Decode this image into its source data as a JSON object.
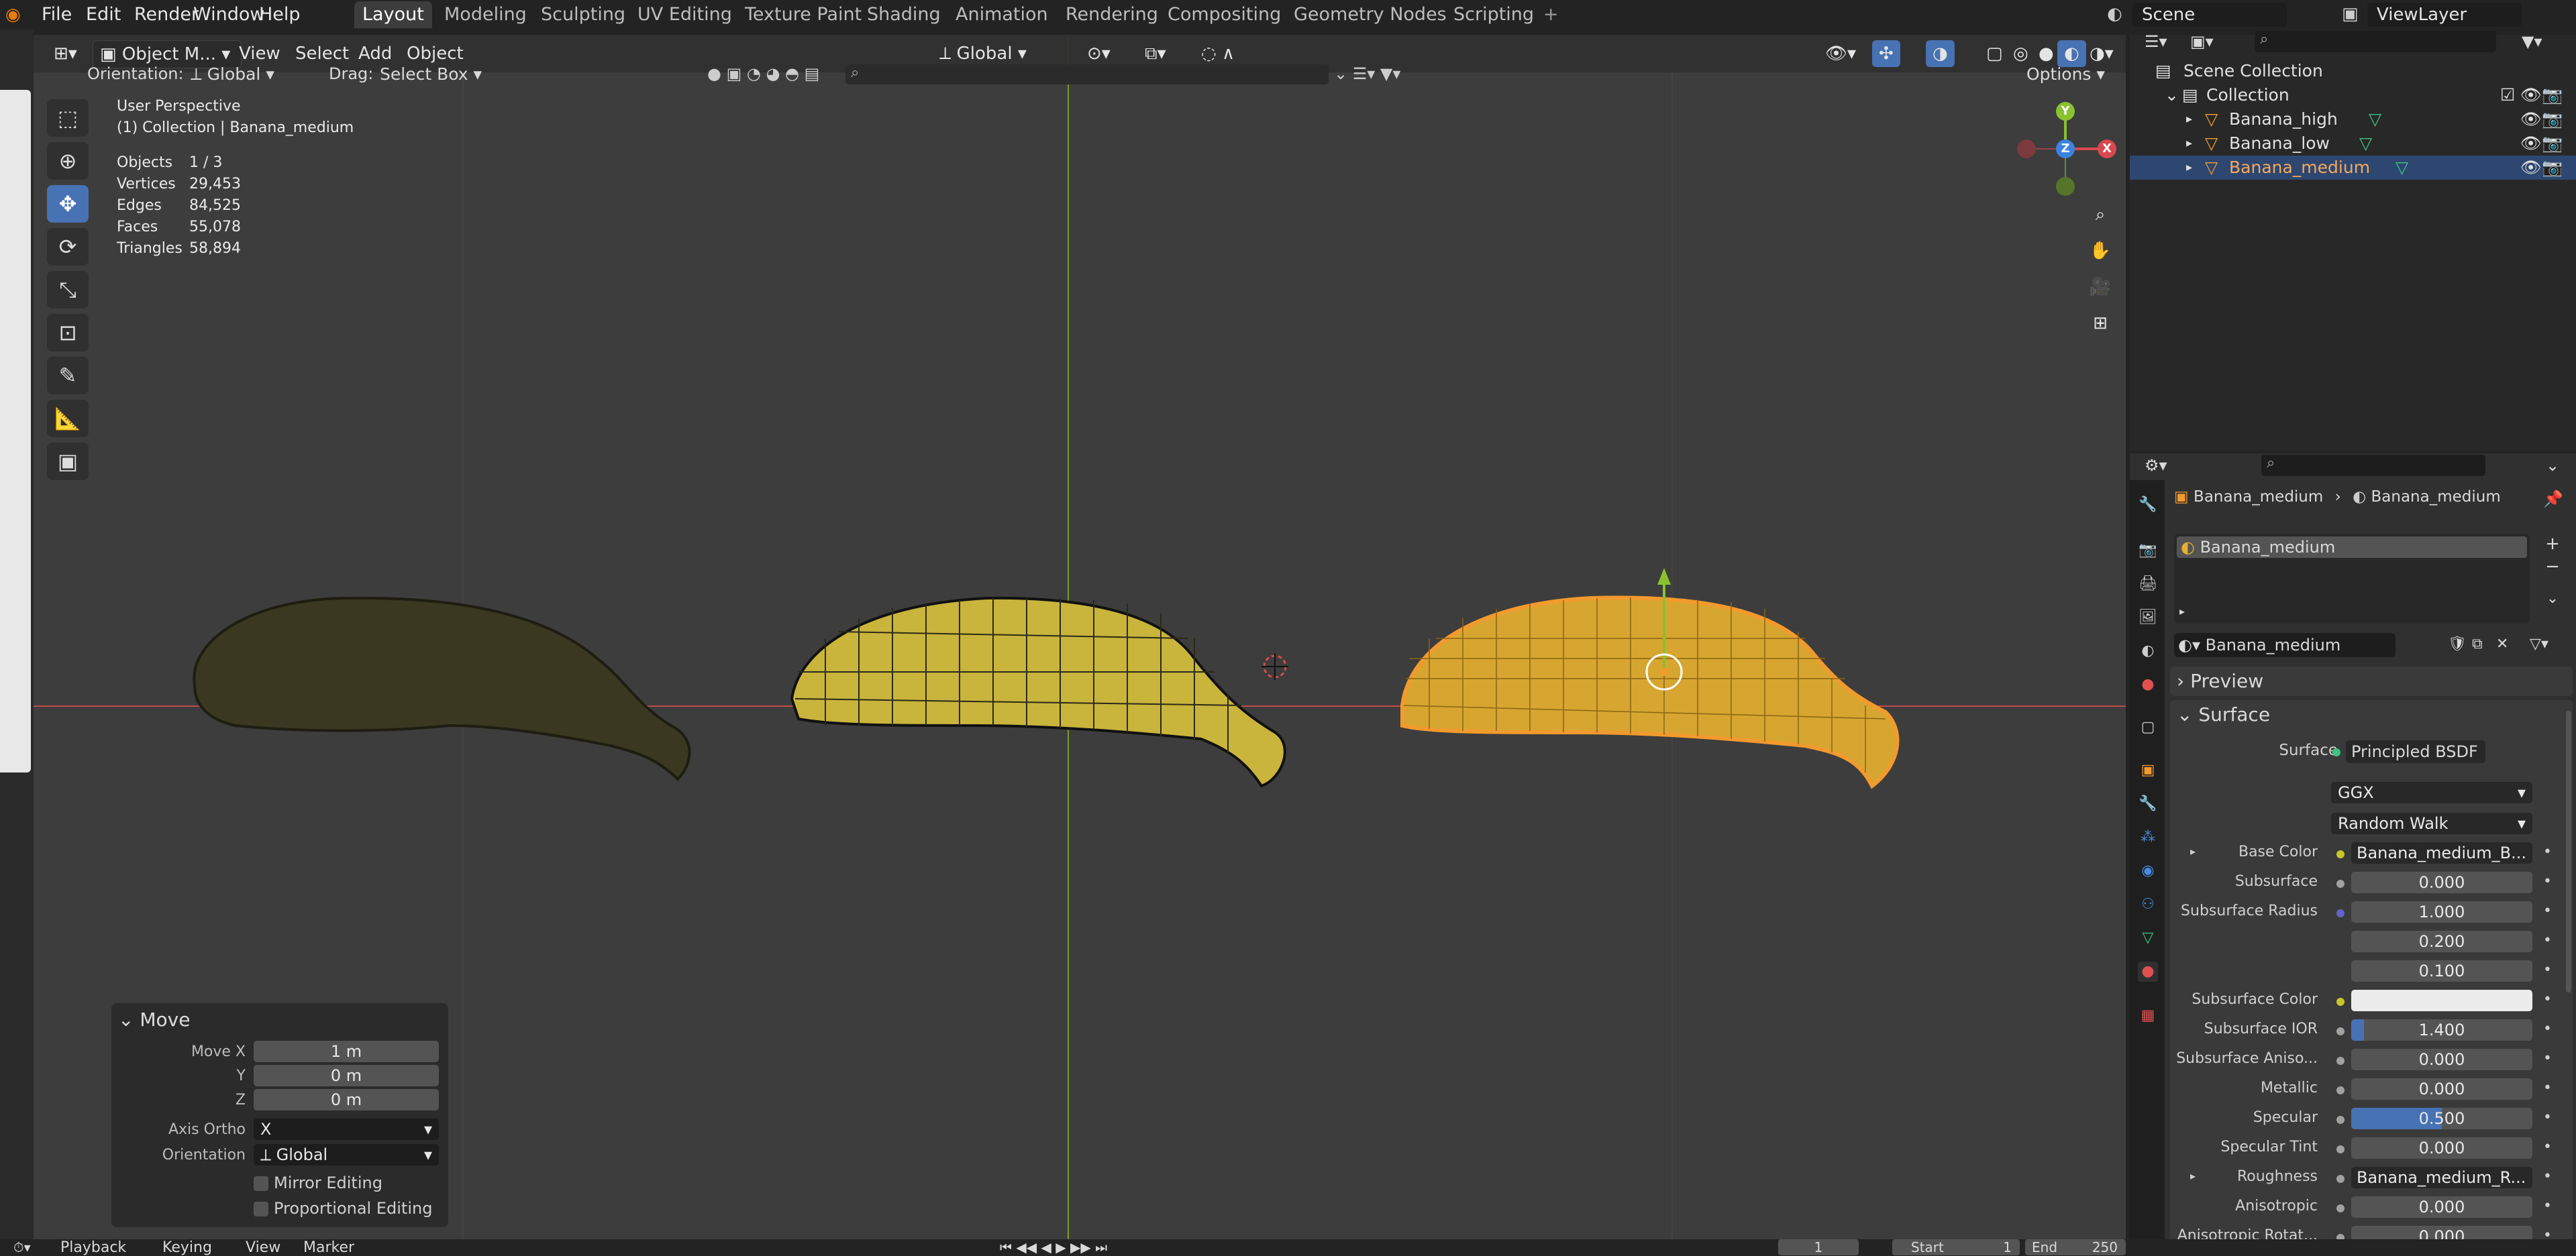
{
  "menu": [
    "File",
    "Edit",
    "Render",
    "Window",
    "Help"
  ],
  "workspaces": [
    "Layout",
    "Modeling",
    "Sculpting",
    "UV Editing",
    "Texture Paint",
    "Shading",
    "Animation",
    "Rendering",
    "Compositing",
    "Geometry Nodes",
    "Scripting"
  ],
  "active_workspace": "Layout",
  "scene_name": "Scene",
  "view_layer": "ViewLayer",
  "viewport_header": {
    "mode": "Object M...",
    "menus": [
      "View",
      "Select",
      "Add",
      "Object"
    ],
    "transform_orientation": "Global"
  },
  "tool_header": {
    "orientation_label": "Orientation:",
    "orientation_value": "Global",
    "drag_label": "Drag:",
    "drag_value": "Select Box",
    "options": "Options"
  },
  "overlay_text": {
    "perspective": "User Perspective",
    "collection": "(1) Collection | Banana_medium"
  },
  "stats": [
    {
      "label": "Objects",
      "value": "1 / 3"
    },
    {
      "label": "Vertices",
      "value": "29,453"
    },
    {
      "label": "Edges",
      "value": "84,525"
    },
    {
      "label": "Faces",
      "value": "55,078"
    },
    {
      "label": "Triangles",
      "value": "58,894"
    }
  ],
  "gizmo_axes": {
    "x": "X",
    "y": "Y",
    "z": "Z"
  },
  "move_panel": {
    "title": "Move",
    "move_x_label": "Move X",
    "move_x": "1 m",
    "y_label": "Y",
    "y": "0 m",
    "z_label": "Z",
    "z": "0 m",
    "axis_ortho_label": "Axis Ortho",
    "axis_ortho": "X",
    "orientation_label": "Orientation",
    "orientation": "Global",
    "mirror_editing": "Mirror Editing",
    "proportional_editing": "Proportional Editing"
  },
  "outliner": {
    "scene_collection": "Scene Collection",
    "collection": "Collection",
    "objects": [
      "Banana_high",
      "Banana_low",
      "Banana_medium"
    ],
    "selected": "Banana_medium"
  },
  "properties": {
    "breadcrumb_object": "Banana_medium",
    "breadcrumb_material": "Banana_medium",
    "slot_name": "Banana_medium",
    "material_name": "Banana_medium",
    "preview_label": "Preview",
    "surface_label": "Surface",
    "surface_field_label": "Surface",
    "surface_shader": "Principled BSDF",
    "distribution": "GGX",
    "subsurface_method": "Random Walk",
    "rows": [
      {
        "label": "Base Color",
        "value": "Banana_medium_B...",
        "type": "texture",
        "dot": "#c7c729",
        "expand": true
      },
      {
        "label": "Subsurface",
        "value": "0.000",
        "type": "number",
        "dot": "#a1a1a1"
      },
      {
        "label": "Subsurface Radius",
        "value": "1.000",
        "type": "number",
        "dot": "#6363c7"
      },
      {
        "label": "",
        "value": "0.200",
        "type": "number"
      },
      {
        "label": "",
        "value": "0.100",
        "type": "number"
      },
      {
        "label": "Subsurface Color",
        "value": "",
        "type": "color",
        "dot": "#c7c729"
      },
      {
        "label": "Subsurface IOR",
        "value": "1.400",
        "type": "number",
        "dot": "#a1a1a1",
        "fill": 0.07
      },
      {
        "label": "Subsurface Aniso...",
        "value": "0.000",
        "type": "number",
        "dot": "#a1a1a1"
      },
      {
        "label": "Metallic",
        "value": "0.000",
        "type": "number",
        "dot": "#a1a1a1"
      },
      {
        "label": "Specular",
        "value": "0.500",
        "type": "number",
        "dot": "#a1a1a1",
        "fill": 0.5
      },
      {
        "label": "Specular Tint",
        "value": "0.000",
        "type": "number",
        "dot": "#a1a1a1"
      },
      {
        "label": "Roughness",
        "value": "Banana_medium_R...",
        "type": "texture",
        "dot": "#a1a1a1",
        "expand": true
      },
      {
        "label": "Anisotropic",
        "value": "0.000",
        "type": "number",
        "dot": "#a1a1a1"
      },
      {
        "label": "Anisotropic Rotat...",
        "value": "0.000",
        "type": "number",
        "dot": "#a1a1a1"
      }
    ]
  },
  "timeline": {
    "menus": [
      "Playback",
      "Keying",
      "View",
      "Marker"
    ],
    "frame": "1",
    "start_label": "Start",
    "start": "1",
    "end_label": "End",
    "end": "250"
  },
  "colors": {
    "accent": "#4772b3",
    "selection_orange": "#f29a2e",
    "x_axis": "#d8484f",
    "y_axis": "#8ac12f",
    "z_axis": "#3b83e0"
  }
}
